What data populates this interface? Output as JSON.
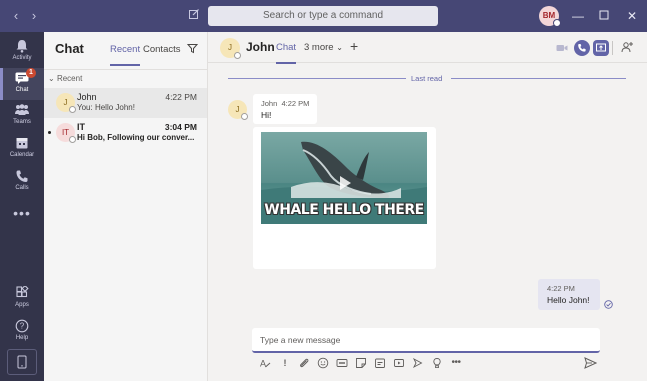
{
  "titlebar": {
    "back_icon": "chevron-left",
    "forward_icon": "chevron-right",
    "compose_icon": "edit-compose",
    "search_placeholder": "Search or type a command",
    "user_initials": "BM",
    "min_icon": "minimize",
    "max_icon": "maximize",
    "close_icon": "close"
  },
  "appbar": {
    "items": [
      {
        "label": "Activity",
        "icon": "bell-icon"
      },
      {
        "label": "Chat",
        "icon": "chat-icon",
        "badge": "1"
      },
      {
        "label": "Teams",
        "icon": "teams-icon"
      },
      {
        "label": "Calendar",
        "icon": "calendar-icon"
      },
      {
        "label": "Calls",
        "icon": "phone-icon"
      }
    ],
    "more": "•••",
    "bottom": [
      {
        "label": "Apps",
        "icon": "apps-icon"
      },
      {
        "label": "Help",
        "icon": "help-icon"
      }
    ]
  },
  "chatlist": {
    "title": "Chat",
    "tabs": [
      "Recent",
      "Contacts"
    ],
    "active_tab": "Recent",
    "section": "Recent",
    "items": [
      {
        "initials": "J",
        "name": "John",
        "time": "4:22 PM",
        "preview": "You: Hello John!",
        "selected": true,
        "unread": false
      },
      {
        "initials": "IT",
        "name": "IT",
        "time": "3:04 PM",
        "preview": "Hi Bob, Following our conver...",
        "selected": false,
        "unread": true
      }
    ]
  },
  "chat": {
    "contact_initial": "J",
    "contact_name": "John",
    "tabs": [
      "Chat",
      "3 more"
    ],
    "last_read": "Last read",
    "incoming": {
      "sender": "John",
      "time": "4:22 PM",
      "text": "Hi!",
      "gif_caption": "WHALE HELLO THERE"
    },
    "outgoing": {
      "time": "4:22 PM",
      "text": "Hello John!"
    },
    "compose_placeholder": "Type a new message"
  },
  "colors": {
    "brand": "#6264a7",
    "titlebar": "#464775",
    "appbar": "#33344a"
  }
}
